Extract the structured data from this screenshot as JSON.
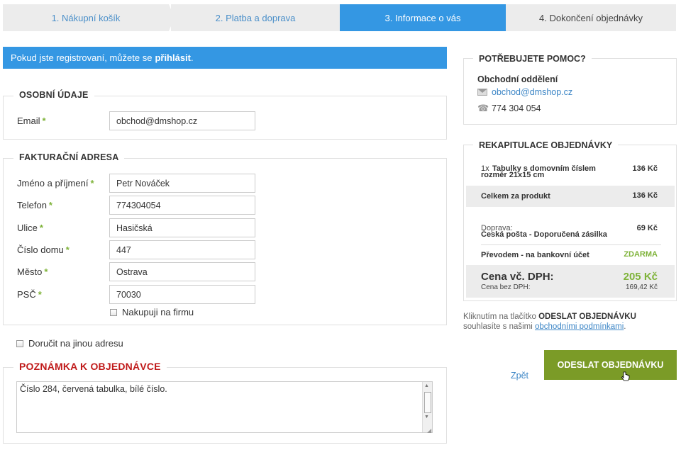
{
  "steps": [
    {
      "label": "1. Nákupní košík"
    },
    {
      "label": "2. Platba a doprava"
    },
    {
      "label": "3. Informace o vás"
    },
    {
      "label": "4. Dokončení objednávky"
    }
  ],
  "info_bar": {
    "text": "Pokud jste registrovaní, můžete se",
    "link": "přihlásit",
    "suffix": "."
  },
  "personal": {
    "title": "OSOBNÍ ÚDAJE",
    "email_label": "Email",
    "email_value": "obchod@dmshop.cz",
    "required_mark": "*"
  },
  "billing": {
    "title": "FAKTURAČNÍ ADRESA",
    "fields": [
      {
        "label": "Jméno a příjmení",
        "value": "Petr Nováček"
      },
      {
        "label": "Telefon",
        "value": "774304054"
      },
      {
        "label": "Ulice",
        "value": "Hasičská"
      },
      {
        "label": "Číslo domu",
        "value": "447"
      },
      {
        "label": "Město",
        "value": "Ostrava"
      },
      {
        "label": "PSČ",
        "value": "70030"
      }
    ],
    "company_checkbox": "Nakupuji na firmu"
  },
  "other_address_checkbox": "Doručit na jinou adresu",
  "note": {
    "title": "POZNÁMKA K OBJEDNÁVCE",
    "value": "Číslo 284, červená tabulka, bílé číslo."
  },
  "help": {
    "title": "POTŘEBUJETE POMOC?",
    "department": "Obchodní oddělení",
    "email": "obchod@dmshop.cz",
    "phone": "774 304 054"
  },
  "recap": {
    "title": "REKAPITULACE OBJEDNÁVKY",
    "item_qty": "1x",
    "item_name_1": "Tabulky s domovním číslem",
    "item_name_2": "rozměr 21x15 cm",
    "item_price": "136 Kč",
    "subtotal_label": "Celkem za produkt",
    "subtotal_price": "136 Kč",
    "shipping_label": "Doprava:",
    "shipping_name": "Česká pošta - Doporučená zásilka",
    "shipping_price": "69 Kč",
    "payment_name": "Převodem - na bankovní účet",
    "payment_price": "ZDARMA",
    "total_label": "Cena vč. DPH:",
    "total_price": "205 Kč",
    "net_label": "Cena bez DPH:",
    "net_price": "169,42 Kč"
  },
  "terms": {
    "prefix": "Kliknutím na tlačítko",
    "button_ref": "ODESLAT OBJEDNÁVKU",
    "middle": "souhlasíte s našimi",
    "link": "obchodními podmínkami",
    "suffix": "."
  },
  "actions": {
    "back": "Zpět",
    "submit": "ODESLAT OBJEDNÁVKU"
  },
  "colors": {
    "accent": "#3497e3",
    "submit": "#7b9b27",
    "required": "#7fb33a",
    "note_title": "#c01a1a"
  }
}
